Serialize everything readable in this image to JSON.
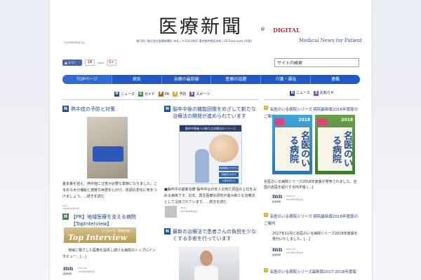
{
  "header": {
    "title": "医療新聞",
    "reg": "®",
    "digital": "DIGITAL",
    "small_logo": "iryoshimbun.jp",
    "company": "発行所 | 株式会社医療新聞社 本社 | 〒114-0001 東京都中野区本町 | 03-5xxx-xxxx (代表)",
    "tagline": "Medical News for Patient"
  },
  "social": {
    "like": "いいね！",
    "count": "18",
    "gplus_label": "Tweet",
    "gplus": "G+"
  },
  "search": {
    "placeholder": "サイト内検索",
    "value": "サイト内検索"
  },
  "nav": [
    {
      "label": "TOPページ"
    },
    {
      "label": "病気"
    },
    {
      "label": "治療の最前線"
    },
    {
      "label": "医療の話題"
    },
    {
      "label": "介護・福祉"
    },
    {
      "label": "連載"
    }
  ],
  "filters": [
    {
      "icon": "N",
      "label": "ニュース"
    },
    {
      "icon": "G",
      "label": "ガイド"
    },
    {
      "icon": "P",
      "label": "PR"
    },
    {
      "icon": "Y",
      "label": "予防"
    },
    {
      "icon": "S",
      "label": "スポーツ"
    }
  ],
  "articles": {
    "a1": {
      "title": "熱中症の予防と対策",
      "body": "夏本番を迎え、熱中症に注意が必要な季節になりました。こまめな水分補給と適度な休憩を心がけ、体調の変化に気をつけましょう。…続きを読む",
      "meta1": "2015",
      "meta2": "2015年08月09日"
    },
    "a2": {
      "title": "脳卒中後の機能回復をめざして新たな治療法の開発が進められています",
      "diagram_head": "脳卒中患者への新たな治療法のイメージ",
      "box1": "神経細胞に分化する",
      "box2": "栄養因子を出す",
      "box3": "炎症を抑える",
      "body": "■脳卒中の最新治療 脳卒中は日本人の死亡原因の上位を占める病気です。近年、再生医療の研究が進み新たな治療法として注目されています。…続きを読む",
      "meta1": "2015",
      "meta2": "2015年08月09日"
    },
    "a3": {
      "title": "【PR】地域医療を支える病院【TopInterview】",
      "banner_small": "どこまでも「患者目線」",
      "banner": "Top Interview",
      "body": "地域に根ざした医療を提供し続ける病院のトップにインタビュー。[…]",
      "meta1": "2015.08",
      "meta2": "2015年08月09日",
      "logo": "mn",
      "logo_sub": "医療新聞"
    },
    "a4": {
      "title": "最新の治療法で患者さんの負担を少なくする手術を行っています"
    }
  },
  "sidebar": {
    "head1": "ニュース",
    "head2": "お知らせ",
    "items": [
      {
        "title": "名医のいる病院シリーズ 病院最新版2018年度版のご案内",
        "book1_title": "名医のいる病院",
        "book2_title": "名医のいる病院",
        "book_year": "2018",
        "body": "名医のいる病院シリーズ2018年度版が発売されました。全国の名医を紹介するPDF版 […]",
        "meta1": "2018.02",
        "meta2": "2018年02月10日",
        "logo": "mn",
        "logo_sub": "医療新聞"
      },
      {
        "title": "名医のいる病院シリーズ 病院最新版2018年度版のご案内",
        "body": "2017年11月に名医のいる病院シリーズ2018年度版を発刊いたしました。[…]",
        "meta1": "2017.11",
        "meta2": "2017年11月09日",
        "logo": "mn",
        "logo_sub": "医療新聞"
      },
      {
        "title": "名医のいる病院シリーズ最新版2017-2018年度版"
      }
    ]
  }
}
